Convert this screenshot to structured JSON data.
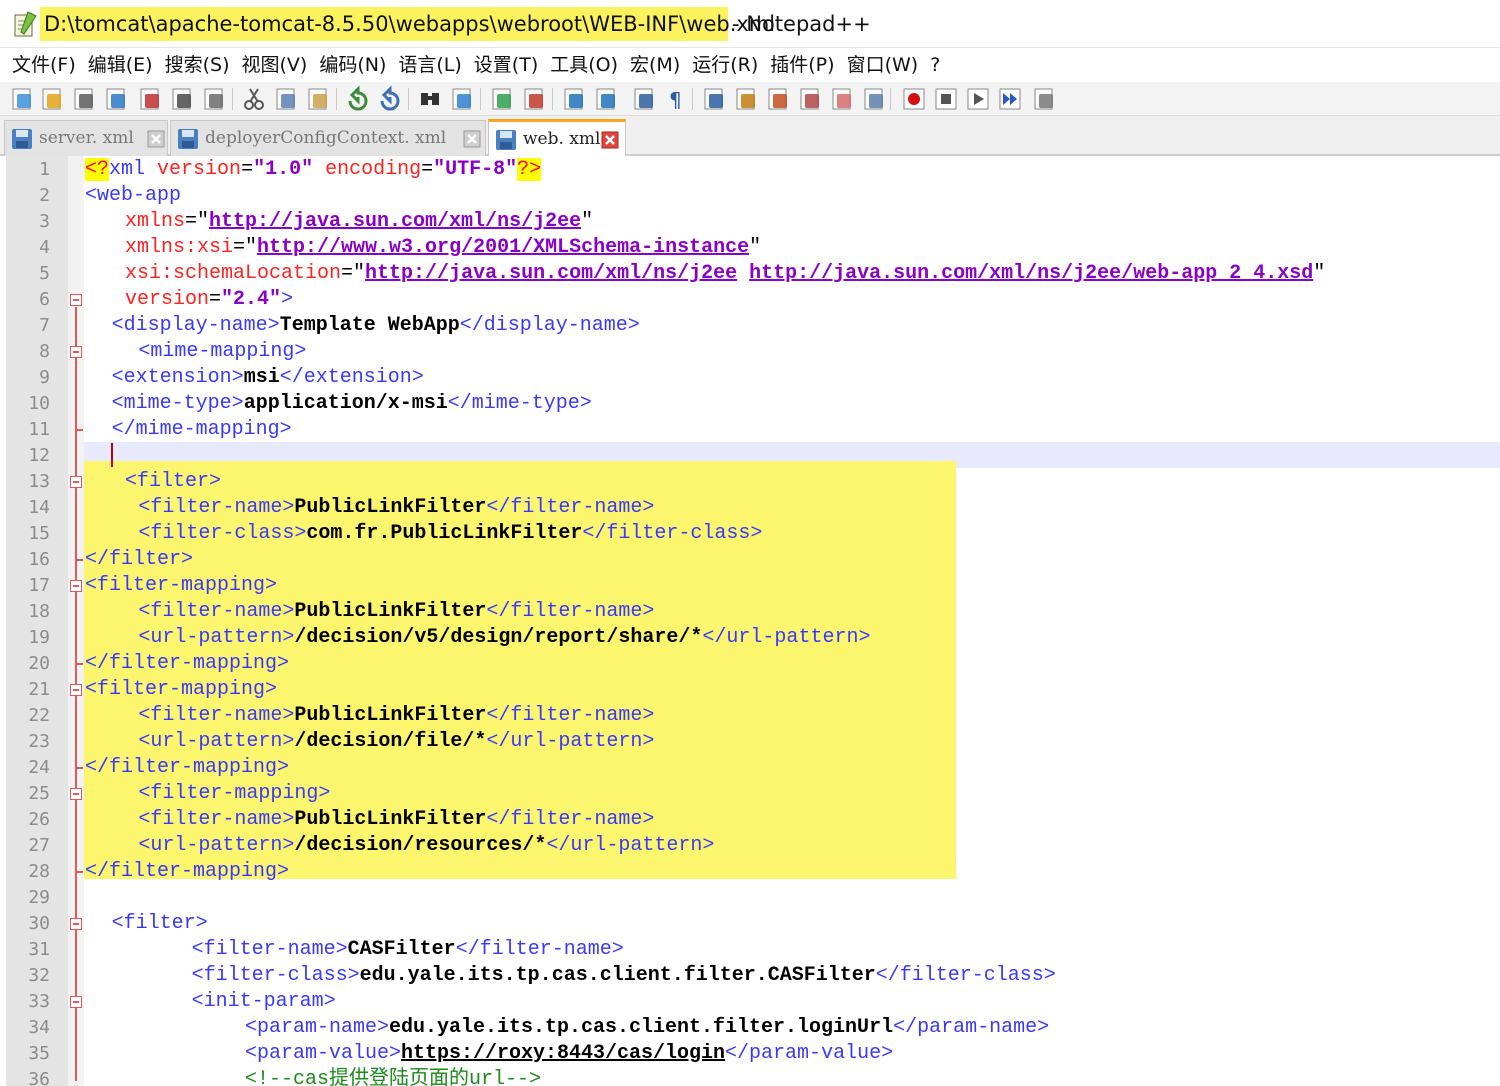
{
  "window": {
    "file_path": "D:\\tomcat\\apache-tomcat-8.5.50\\webapps\\webroot\\WEB-INF\\web.xml",
    "app_suffix": " - Notepad++"
  },
  "menu": [
    "文件(F)",
    "编辑(E)",
    "搜索(S)",
    "视图(V)",
    "编码(N)",
    "语言(L)",
    "设置(T)",
    "工具(O)",
    "宏(M)",
    "运行(R)",
    "插件(P)",
    "窗口(W)",
    "?"
  ],
  "toolbar_icons": [
    "new-file-icon",
    "open-file-icon",
    "save-icon",
    "save-all-icon",
    "close-icon",
    "close-all-icon",
    "print-icon",
    "cut-icon",
    "copy-icon",
    "paste-icon",
    "undo-icon",
    "redo-icon",
    "find-icon",
    "replace-icon",
    "zoom-in-icon",
    "zoom-out-icon",
    "sync-vertical-icon",
    "sync-horizontal-icon",
    "word-wrap-icon",
    "show-all-chars-icon",
    "indent-guide-icon",
    "language-icon",
    "doc-map-icon",
    "function-list-icon",
    "folder-workspace-icon",
    "monitor-icon",
    "record-macro-icon",
    "stop-macro-icon",
    "play-macro-icon",
    "run-macro-multiple-icon",
    "save-macro-icon"
  ],
  "tabs": [
    {
      "label": "server. xml",
      "active": false
    },
    {
      "label": "deployerConfigContext. xml",
      "active": false
    },
    {
      "label": "web. xml",
      "active": true
    }
  ],
  "editor": {
    "current_line": 12,
    "line_numbers": [
      "1",
      "2",
      "3",
      "4",
      "5",
      "6",
      "7",
      "8",
      "9",
      "10",
      "11",
      "12",
      "13",
      "14",
      "15",
      "16",
      "17",
      "18",
      "19",
      "20",
      "21",
      "22",
      "23",
      "24",
      "25",
      "26",
      "27",
      "28",
      "29",
      "30",
      "31",
      "32",
      "33",
      "34",
      "35",
      "36"
    ],
    "lines": [
      {
        "indent": 0,
        "tokens": [
          {
            "k": "pi",
            "t": "<?"
          },
          {
            "k": "t",
            "t": "xml"
          },
          {
            "k": "q",
            "t": " "
          },
          {
            "k": "a",
            "t": "version"
          },
          {
            "k": "q",
            "t": "="
          },
          {
            "k": "v",
            "t": "\"1.0\""
          },
          {
            "k": "q",
            "t": " "
          },
          {
            "k": "a",
            "t": "encoding"
          },
          {
            "k": "q",
            "t": "="
          },
          {
            "k": "v",
            "t": "\"UTF-8\""
          },
          {
            "k": "pi",
            "t": "?>"
          }
        ]
      },
      {
        "indent": 0,
        "tokens": [
          {
            "k": "t",
            "t": "<web-app"
          }
        ]
      },
      {
        "indent": 3,
        "tokens": [
          {
            "k": "a",
            "t": "xmlns"
          },
          {
            "k": "q",
            "t": "=\""
          },
          {
            "k": "u",
            "t": "http://java.sun.com/xml/ns/j2ee"
          },
          {
            "k": "q",
            "t": "\""
          }
        ]
      },
      {
        "indent": 3,
        "tokens": [
          {
            "k": "a",
            "t": "xmlns:xsi"
          },
          {
            "k": "q",
            "t": "=\""
          },
          {
            "k": "u",
            "t": "http://www.w3.org/2001/XMLSchema-instance"
          },
          {
            "k": "q",
            "t": "\""
          }
        ]
      },
      {
        "indent": 3,
        "tokens": [
          {
            "k": "a",
            "t": "xsi:schemaLocation"
          },
          {
            "k": "q",
            "t": "=\""
          },
          {
            "k": "u",
            "t": "http://java.sun.com/xml/ns/j2ee"
          },
          {
            "k": "q",
            "t": " "
          },
          {
            "k": "u",
            "t": "http://java.sun.com/xml/ns/j2ee/web-app_2_4.xsd"
          },
          {
            "k": "q",
            "t": "\""
          }
        ]
      },
      {
        "indent": 3,
        "tokens": [
          {
            "k": "a",
            "t": "version"
          },
          {
            "k": "q",
            "t": "="
          },
          {
            "k": "v",
            "t": "\"2.4\""
          },
          {
            "k": "t",
            "t": ">"
          }
        ]
      },
      {
        "indent": 2,
        "tokens": [
          {
            "k": "t",
            "t": "<display-name>"
          },
          {
            "k": "b",
            "t": "Template WebApp"
          },
          {
            "k": "t",
            "t": "</display-name>"
          }
        ]
      },
      {
        "indent": 4,
        "tokens": [
          {
            "k": "t",
            "t": "<mime-mapping>"
          }
        ]
      },
      {
        "indent": 2,
        "tokens": [
          {
            "k": "t",
            "t": "<extension>"
          },
          {
            "k": "b",
            "t": "msi"
          },
          {
            "k": "t",
            "t": "</extension>"
          }
        ]
      },
      {
        "indent": 2,
        "tokens": [
          {
            "k": "t",
            "t": "<mime-type>"
          },
          {
            "k": "b",
            "t": "application/x-msi"
          },
          {
            "k": "t",
            "t": "</mime-type>"
          }
        ]
      },
      {
        "indent": 2,
        "tokens": [
          {
            "k": "t",
            "t": "</mime-mapping>"
          }
        ]
      },
      {
        "indent": 0,
        "tokens": []
      },
      {
        "indent": 3,
        "tokens": [
          {
            "k": "t",
            "t": "<filter>"
          }
        ]
      },
      {
        "indent": 4,
        "tokens": [
          {
            "k": "t",
            "t": "<filter-name>"
          },
          {
            "k": "b",
            "t": "PublicLinkFilter"
          },
          {
            "k": "t",
            "t": "</filter-name>"
          }
        ]
      },
      {
        "indent": 4,
        "tokens": [
          {
            "k": "t",
            "t": "<filter-class>"
          },
          {
            "k": "b",
            "t": "com.fr.PublicLinkFilter"
          },
          {
            "k": "t",
            "t": "</filter-class>"
          }
        ]
      },
      {
        "indent": 0,
        "tokens": [
          {
            "k": "t",
            "t": "</filter>"
          }
        ]
      },
      {
        "indent": 0,
        "tokens": [
          {
            "k": "t",
            "t": "<filter-mapping>"
          }
        ]
      },
      {
        "indent": 4,
        "tokens": [
          {
            "k": "t",
            "t": "<filter-name>"
          },
          {
            "k": "b",
            "t": "PublicLinkFilter"
          },
          {
            "k": "t",
            "t": "</filter-name>"
          }
        ]
      },
      {
        "indent": 4,
        "tokens": [
          {
            "k": "t",
            "t": "<url-pattern>"
          },
          {
            "k": "b",
            "t": "/decision/v5/design/report/share/*"
          },
          {
            "k": "t",
            "t": "</url-pattern>"
          }
        ]
      },
      {
        "indent": 0,
        "tokens": [
          {
            "k": "t",
            "t": "</filter-mapping>"
          }
        ]
      },
      {
        "indent": 0,
        "tokens": [
          {
            "k": "t",
            "t": "<filter-mapping>"
          }
        ]
      },
      {
        "indent": 4,
        "tokens": [
          {
            "k": "t",
            "t": "<filter-name>"
          },
          {
            "k": "b",
            "t": "PublicLinkFilter"
          },
          {
            "k": "t",
            "t": "</filter-name>"
          }
        ]
      },
      {
        "indent": 4,
        "tokens": [
          {
            "k": "t",
            "t": "<url-pattern>"
          },
          {
            "k": "b",
            "t": "/decision/file/*"
          },
          {
            "k": "t",
            "t": "</url-pattern>"
          }
        ]
      },
      {
        "indent": 0,
        "tokens": [
          {
            "k": "t",
            "t": "</filter-mapping>"
          }
        ]
      },
      {
        "indent": 4,
        "tokens": [
          {
            "k": "t",
            "t": "<filter-mapping>"
          }
        ]
      },
      {
        "indent": 4,
        "tokens": [
          {
            "k": "t",
            "t": "<filter-name>"
          },
          {
            "k": "b",
            "t": "PublicLinkFilter"
          },
          {
            "k": "t",
            "t": "</filter-name>"
          }
        ]
      },
      {
        "indent": 4,
        "tokens": [
          {
            "k": "t",
            "t": "<url-pattern>"
          },
          {
            "k": "b",
            "t": "/decision/resources/*"
          },
          {
            "k": "t",
            "t": "</url-pattern>"
          }
        ]
      },
      {
        "indent": 0,
        "tokens": [
          {
            "k": "t",
            "t": "</filter-mapping>"
          }
        ]
      },
      {
        "indent": 0,
        "tokens": []
      },
      {
        "indent": 2,
        "tokens": [
          {
            "k": "t",
            "t": "<filter>"
          }
        ]
      },
      {
        "indent": 8,
        "tokens": [
          {
            "k": "t",
            "t": "<filter-name>"
          },
          {
            "k": "b",
            "t": "CASFilter"
          },
          {
            "k": "t",
            "t": "</filter-name>"
          }
        ]
      },
      {
        "indent": 8,
        "tokens": [
          {
            "k": "t",
            "t": "<filter-class>"
          },
          {
            "k": "b",
            "t": "edu.yale.its.tp.cas.client.filter.CASFilter"
          },
          {
            "k": "t",
            "t": "</filter-class>"
          }
        ]
      },
      {
        "indent": 8,
        "tokens": [
          {
            "k": "t",
            "t": "<init-param>"
          }
        ]
      },
      {
        "indent": 12,
        "tokens": [
          {
            "k": "t",
            "t": "<param-name>"
          },
          {
            "k": "b",
            "t": "edu.yale.its.tp.cas.client.filter.loginUrl"
          },
          {
            "k": "t",
            "t": "</param-name>"
          }
        ]
      },
      {
        "indent": 12,
        "tokens": [
          {
            "k": "t",
            "t": "<param-value>"
          },
          {
            "k": "u2",
            "t": "https://roxy:8443/cas/login"
          },
          {
            "k": "t",
            "t": "</param-value>"
          }
        ]
      },
      {
        "indent": 12,
        "tokens": [
          {
            "k": "c",
            "t": "<!--cas提供登陆页面的url-->"
          }
        ]
      }
    ]
  }
}
